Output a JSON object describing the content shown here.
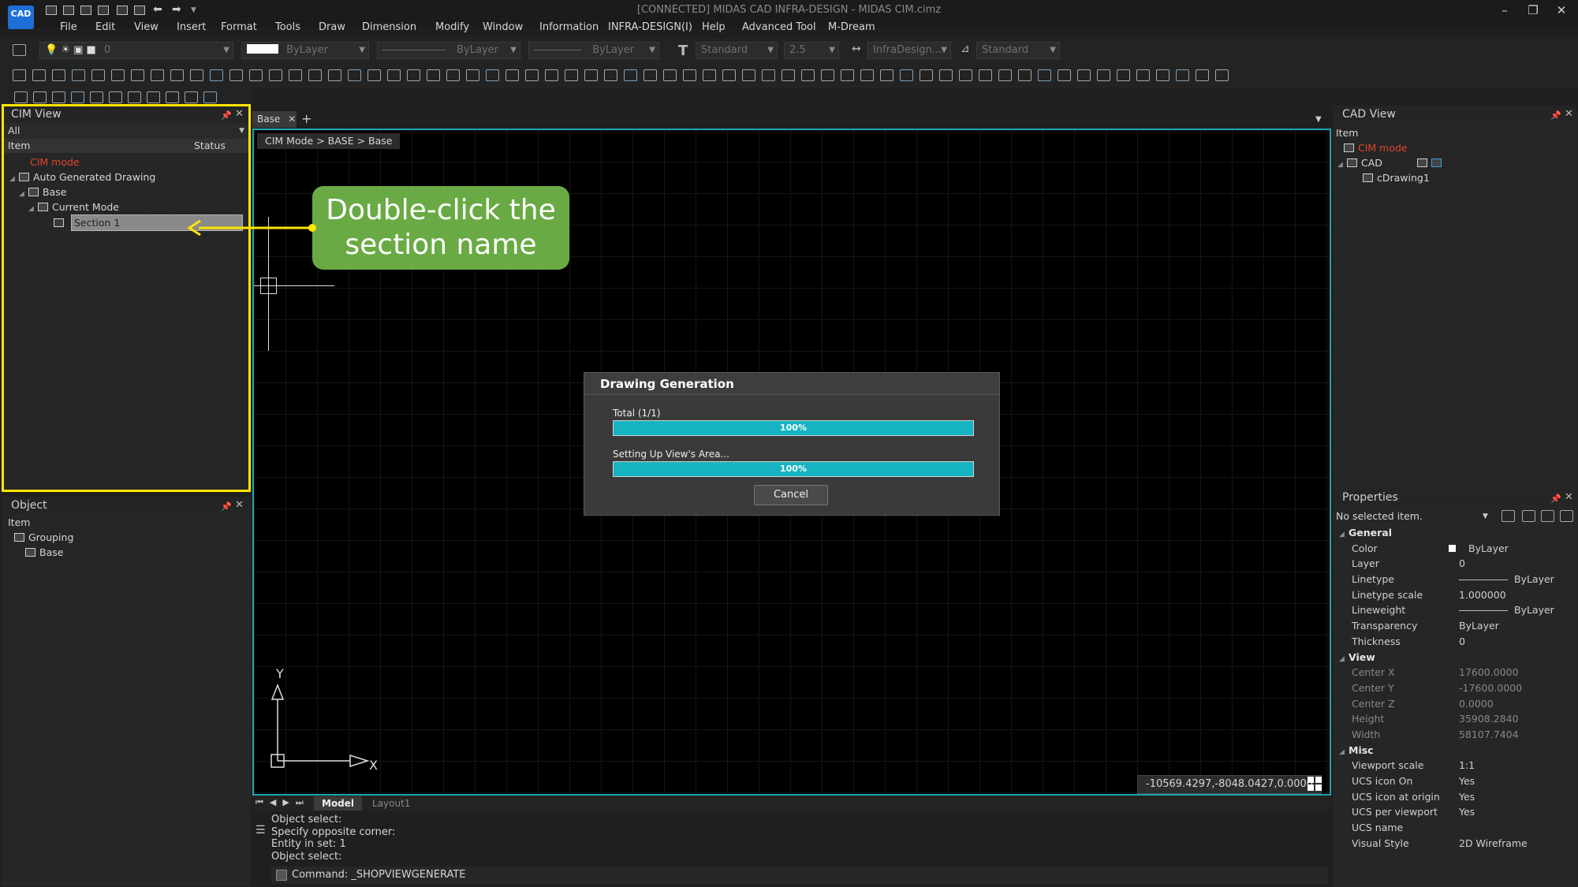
{
  "app": {
    "logo_text": "CAD",
    "window_title": "[CONNECTED] MIDAS CAD INFRA-DESIGN - MIDAS CIM.cimz",
    "controls": {
      "minimize": "–",
      "restore": "❐",
      "close": "✕"
    }
  },
  "menu": [
    "File",
    "Edit",
    "View",
    "Insert",
    "Format",
    "Tools",
    "Draw",
    "Dimension",
    "Modify",
    "Window",
    "Information",
    "INFRA-DESIGN(I)",
    "Help",
    "Advanced Tool",
    "M-Dream"
  ],
  "toolbar": {
    "layer_value": "0",
    "color_value": "ByLayer",
    "linetype_value": "ByLayer",
    "lineweight_value": "ByLayer",
    "text_style": "Standard",
    "text_height": "2.5",
    "dim_style": "InfraDesign...",
    "table_style": "Standard"
  },
  "cim_view": {
    "title": "CIM View",
    "filter": "All",
    "col_item": "Item",
    "col_status": "Status",
    "tree": {
      "mode": "CIM mode",
      "auto": "Auto Generated Drawing",
      "base": "Base",
      "current": "Current Mode",
      "section": "Section 1"
    }
  },
  "object_panel": {
    "title": "Object",
    "col_item": "Item",
    "grouping": "Grouping",
    "base": "Base"
  },
  "tabs": {
    "active": "Base",
    "add": "+"
  },
  "breadcrumb": "CIM Mode > BASE > Base",
  "callout": {
    "line1": "Double-click the",
    "line2": "section name"
  },
  "axes": {
    "y": "Y",
    "x": "X"
  },
  "dialog": {
    "title": "Drawing Generation",
    "total_label": "Total (1/1)",
    "total_progress": 100,
    "total_text": "100%",
    "step_label": "Setting Up View's Area...",
    "step_progress": 100,
    "step_text": "100%",
    "cancel": "Cancel"
  },
  "coords": "-10569.4297,-8048.0427,0.0000",
  "layout_tabs": {
    "model": "Model",
    "layout1": "Layout1"
  },
  "command_history": [
    "Object select:",
    "Specify opposite corner:",
    "Entity in set: 1",
    "Object select:"
  ],
  "command_prompt": "Command:  _SHOPVIEWGENERATE",
  "cad_view": {
    "title": "CAD View",
    "col_item": "Item",
    "mode": "CIM mode",
    "cad": "CAD",
    "drawing": "cDrawing1"
  },
  "properties": {
    "title": "Properties",
    "selection": "No selected item.",
    "general": "General",
    "view": "View",
    "misc": "Misc",
    "general_rows": [
      {
        "k": "Color",
        "v": "ByLayer"
      },
      {
        "k": "Layer",
        "v": "0"
      },
      {
        "k": "Linetype",
        "v": "ByLayer"
      },
      {
        "k": "Linetype scale",
        "v": "1.000000"
      },
      {
        "k": "Lineweight",
        "v": "ByLayer"
      },
      {
        "k": "Transparency",
        "v": "ByLayer"
      },
      {
        "k": "Thickness",
        "v": "0"
      }
    ],
    "view_rows": [
      {
        "k": "Center X",
        "v": "17600.0000"
      },
      {
        "k": "Center Y",
        "v": "-17600.0000"
      },
      {
        "k": "Center Z",
        "v": "0.0000"
      },
      {
        "k": "Height",
        "v": "35908.2840"
      },
      {
        "k": "Width",
        "v": "58107.7404"
      }
    ],
    "misc_rows": [
      {
        "k": "Viewport scale",
        "v": "1:1"
      },
      {
        "k": "UCS icon On",
        "v": "Yes"
      },
      {
        "k": "UCS icon at origin",
        "v": "Yes"
      },
      {
        "k": "UCS per viewport",
        "v": "Yes"
      },
      {
        "k": "UCS name",
        "v": ""
      },
      {
        "k": "Visual Style",
        "v": "2D Wireframe"
      }
    ]
  },
  "colors": {
    "accent": "#1fa2b0",
    "highlight": "#ffe500",
    "callout": "#6aaa45",
    "mode_red": "#e0452b",
    "progress": "#16b4c2"
  }
}
